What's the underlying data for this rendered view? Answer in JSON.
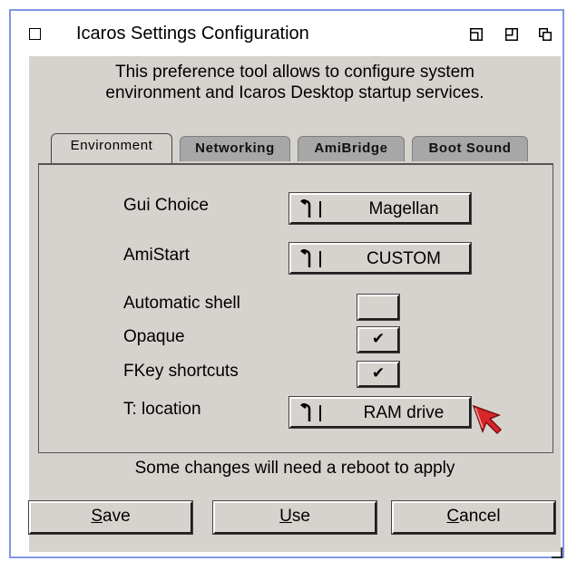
{
  "window": {
    "title": "Icaros Settings Configuration",
    "border_color": "#7f97e8",
    "background_color": "#d6d3ce"
  },
  "intro": {
    "line1": "This preference tool allows to configure system",
    "line2": "environment and Icaros Desktop startup services."
  },
  "tabs": [
    {
      "label": "Environment",
      "active": true
    },
    {
      "label": "Networking",
      "active": false
    },
    {
      "label": "AmiBridge",
      "active": false
    },
    {
      "label": "Boot Sound",
      "active": false
    }
  ],
  "settings": {
    "gui_choice": {
      "label": "Gui Choice",
      "value": "Magellan"
    },
    "amistart": {
      "label": "AmiStart",
      "value": "CUSTOM"
    },
    "automatic_shell": {
      "label": "Automatic shell",
      "checked": false,
      "mark": ""
    },
    "opaque": {
      "label": "Opaque",
      "checked": true,
      "mark": "✔"
    },
    "fkey_shortcuts": {
      "label": "FKey shortcuts",
      "checked": true,
      "mark": "✔"
    },
    "t_location": {
      "label": "T: location",
      "value": "RAM drive"
    }
  },
  "status_text": "Some changes will need a reboot to apply",
  "buttons": {
    "save": {
      "first": "S",
      "rest": "ave"
    },
    "use": {
      "first": "U",
      "rest": "se"
    },
    "cancel": {
      "first": "C",
      "rest": "ancel"
    }
  },
  "icons": {
    "close": "close-icon",
    "cycle": "cycle-icon",
    "pointer": "mouse-pointer-icon",
    "pointer_color": "#d8262b"
  }
}
